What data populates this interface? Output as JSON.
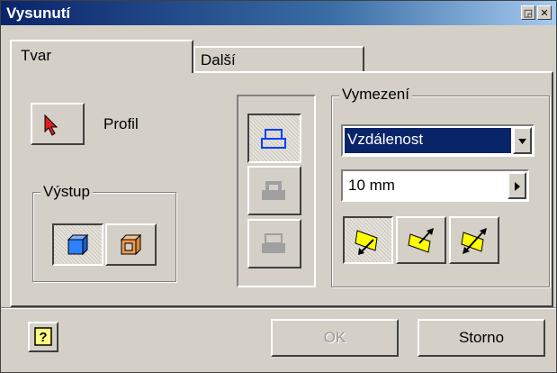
{
  "window": {
    "title": "Vysunutí",
    "controls": {
      "pin": "◲",
      "close": "✕"
    }
  },
  "tabs": [
    {
      "label": "Tvar",
      "active": true
    },
    {
      "label": "Další",
      "active": false
    }
  ],
  "profile": {
    "label": "Profil",
    "icon": "select-arrow-icon"
  },
  "output": {
    "group_label": "Výstup",
    "buttons": [
      {
        "icon": "solid-cube-icon",
        "pressed": true
      },
      {
        "icon": "surface-cube-icon",
        "pressed": false
      }
    ]
  },
  "operation": {
    "buttons": [
      {
        "icon": "join-icon",
        "pressed": true,
        "enabled": true
      },
      {
        "icon": "cut-icon",
        "pressed": false,
        "enabled": false
      },
      {
        "icon": "intersect-icon",
        "pressed": false,
        "enabled": false
      }
    ]
  },
  "extents": {
    "group_label": "Vymezení",
    "type_value": "Vzdálenost",
    "distance_value": "10 mm",
    "direction_buttons": [
      {
        "icon": "direction-1-icon",
        "pressed": true
      },
      {
        "icon": "direction-2-icon",
        "pressed": false
      },
      {
        "icon": "symmetric-direction-icon",
        "pressed": false
      }
    ]
  },
  "footer": {
    "help_icon": "help-question-icon",
    "ok_label": "OK",
    "cancel_label": "Storno"
  },
  "colors": {
    "title_start": "#0a246a",
    "title_end": "#a6caf0",
    "dialog_bg": "#d4d0c8",
    "selection": "#0a246a",
    "highlight_yellow": "#ffff00"
  }
}
